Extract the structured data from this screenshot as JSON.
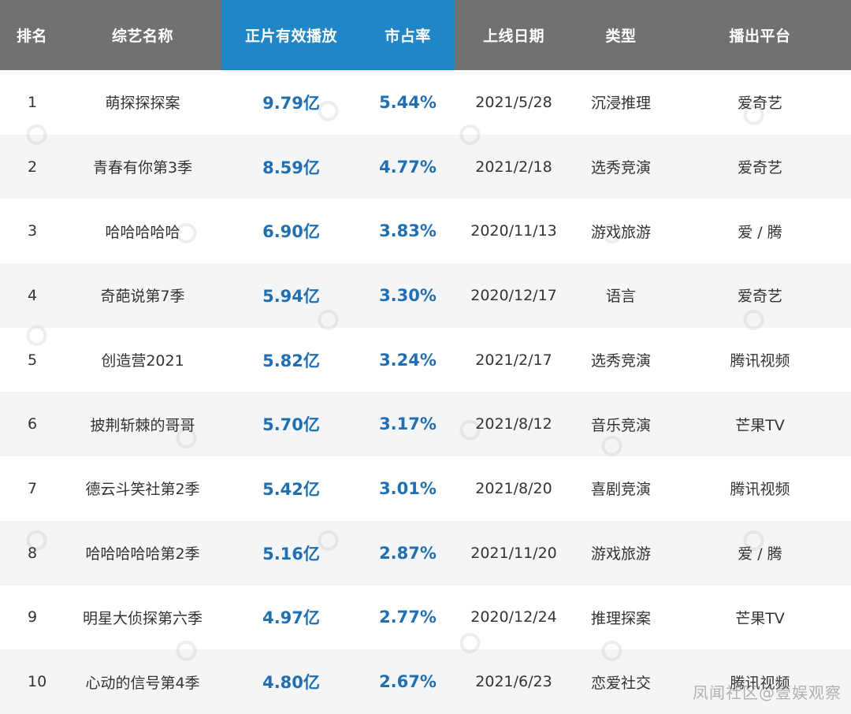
{
  "header": {
    "columns": [
      "排名",
      "综艺名称",
      "正片有效播放",
      "市占率",
      "上线日期",
      "类型",
      "播出平台"
    ]
  },
  "rows": [
    {
      "rank": "1",
      "name": "萌探探探案",
      "plays": "9.79亿",
      "share": "5.44%",
      "date": "2021/5/28",
      "genre": "沉浸推理",
      "platform": "爱奇艺"
    },
    {
      "rank": "2",
      "name": "青春有你第3季",
      "plays": "8.59亿",
      "share": "4.77%",
      "date": "2021/2/18",
      "genre": "选秀竞演",
      "platform": "爱奇艺"
    },
    {
      "rank": "3",
      "name": "哈哈哈哈哈",
      "plays": "6.90亿",
      "share": "3.83%",
      "date": "2020/11/13",
      "genre": "游戏旅游",
      "platform": "爱 / 腾"
    },
    {
      "rank": "4",
      "name": "奇葩说第7季",
      "plays": "5.94亿",
      "share": "3.30%",
      "date": "2020/12/17",
      "genre": "语言",
      "platform": "爱奇艺"
    },
    {
      "rank": "5",
      "name": "创造营2021",
      "plays": "5.82亿",
      "share": "3.24%",
      "date": "2021/2/17",
      "genre": "选秀竞演",
      "platform": "腾讯视频"
    },
    {
      "rank": "6",
      "name": "披荆斩棘的哥哥",
      "plays": "5.70亿",
      "share": "3.17%",
      "date": "2021/8/12",
      "genre": "音乐竞演",
      "platform": "芒果TV"
    },
    {
      "rank": "7",
      "name": "德云斗笑社第2季",
      "plays": "5.42亿",
      "share": "3.01%",
      "date": "2021/8/20",
      "genre": "喜剧竞演",
      "platform": "腾讯视频"
    },
    {
      "rank": "8",
      "name": "哈哈哈哈哈第2季",
      "plays": "5.16亿",
      "share": "2.87%",
      "date": "2021/11/20",
      "genre": "游戏旅游",
      "platform": "爱 / 腾"
    },
    {
      "rank": "9",
      "name": "明星大侦探第六季",
      "plays": "4.97亿",
      "share": "2.77%",
      "date": "2020/12/24",
      "genre": "推理探案",
      "platform": "芒果TV"
    },
    {
      "rank": "10",
      "name": "心动的信号第4季",
      "plays": "4.80亿",
      "share": "2.67%",
      "date": "2021/6/23",
      "genre": "恋爱社交",
      "platform": "腾讯视频"
    }
  ],
  "footer_watermark": "凤闻社区@壹娱观察",
  "colors": {
    "header_bg": "#707171",
    "header_highlight": "#1f86c8",
    "value_blue": "#1f6fb2",
    "row_alt": "#f4f5f6"
  }
}
